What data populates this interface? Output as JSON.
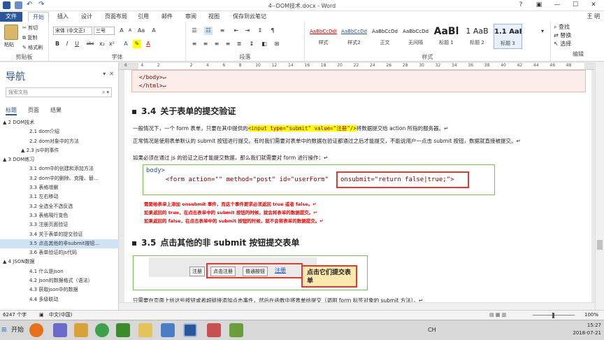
{
  "window": {
    "title": "4--DOM技术.docx - Word",
    "user": "王 明"
  },
  "tabs": [
    "文件",
    "开始",
    "插入",
    "设计",
    "页面布局",
    "引用",
    "邮件",
    "审阅",
    "视图",
    "保存到云笔记"
  ],
  "ribbon": {
    "clipboard": {
      "paste": "粘贴",
      "cut": "剪切",
      "copy": "复制",
      "format_painter": "格式刷",
      "label": "剪贴板"
    },
    "font": {
      "name": "宋体 (中文正)",
      "size": "三号",
      "label": "字体",
      "buttons": [
        "B",
        "I",
        "U",
        "abc",
        "x₂",
        "x²"
      ],
      "size_buttons": [
        "A",
        "A",
        "Aa",
        "A"
      ]
    },
    "paragraph": {
      "label": "段落"
    },
    "styles": {
      "label": "样式",
      "items": [
        {
          "preview": "AaBbCcDdI",
          "name": "样式"
        },
        {
          "preview": "AaBbCcDd",
          "name": "样式2"
        },
        {
          "preview": "AaBbCcDd",
          "name": "正文"
        },
        {
          "preview": "AaBbCcDd",
          "name": "无间隔"
        },
        {
          "preview": "AaBl",
          "name": "标题 1"
        },
        {
          "preview": "1 AaB",
          "name": "标题 2"
        },
        {
          "preview": "1.1 AaB",
          "name": "标题 3"
        }
      ]
    },
    "editing": {
      "label": "编辑",
      "find": "查找",
      "replace": "替换",
      "select": "选择"
    }
  },
  "ruler_ticks": [
    "6",
    "4",
    "2",
    "",
    "2",
    "4",
    "6",
    "8",
    "10",
    "12",
    "14",
    "16",
    "18",
    "20",
    "22",
    "24",
    "26",
    "28",
    "30",
    "32",
    "34",
    "36",
    "38",
    "40",
    "42",
    "44",
    "46",
    "48"
  ],
  "nav": {
    "title": "导航",
    "search_placeholder": "搜索文档",
    "tabs": [
      "标题",
      "页面",
      "结果"
    ],
    "items": [
      "▲ 2 DOM技术",
      "2.1 dom介绍",
      "2.2 dom对象中的方法",
      "▲ 2.3 js中的事件",
      "▲ 3 DOM练习",
      "3.1 dom中的创建和添加方法",
      "3.2 dom中的删除、克隆、替...",
      "3.3 表格增删",
      "3.1 左右移动",
      "3.2 全选全不选反选",
      "3.3 表格隔行变色",
      "3.3 注册页面验证",
      "3.4 关于表单的提交验证",
      "3.5 点击其他的非submit按钮...",
      "3.6 表单验证的js代码",
      "▲ 4 JSON数据",
      "4.1 什么是json",
      "4.2 json的数据格式（语法）",
      "4.3 获取json中的数据",
      "4.4 多级联动"
    ],
    "selected_index": 13
  },
  "doc": {
    "code_top": [
      "</body>↵",
      "</html>↵"
    ],
    "h34": {
      "num": "3.4",
      "text": "关于表单的提交验证"
    },
    "p1_a": "一般情况下，一个 form 表单，只要在其中提供的",
    "p1_hl": "<input type=\"submit\" value=\"注册\"/>",
    "p1_b": "将数据提交给 action 所指的服务器。↵",
    "p2": "正常情况是使用表单默认的 submit 按钮进行提交。有时我们需要对表单中的数据在验证都通过之后才能提交，不能说用户一点击 submit 按钮，数据就直接被提交。↵",
    "p3": "如果必须在通过 js 的验证之后才能提交数据，那么我们就需要对 form 进行操作：↵",
    "code_line1": "body>",
    "code_line2": "<form action=\"\" method=\"post\" id=\"userForm\"",
    "code_line2b": "onsubmit=\"return false|true;\">",
    "notes": [
      "需要给表单上添加 onsubmit 事件，而这个事件要求必须返回 true 或者 false。↵",
      "如果返回的 true，在点击表单中的 submit 按钮的时候，就会将表单的数据提交。↵",
      "如果返回的 false，在点击表单中的 submit 按钮的时候，就不会将表单的数据提交。↵"
    ],
    "h35": {
      "num": "3.5",
      "text": "点击其他的非 submit 按钮提交表单"
    },
    "demo_buttons": [
      "注册",
      "点击注册",
      "普通按钮"
    ],
    "demo_link": "注册",
    "callout": "点击它们提交表单",
    "p4": "只需要在页面上给这些按钮或者超链接添加点击事件，然后在函数中将表单给提交（调用 form 标签对象的 submit 方法）。↵"
  },
  "status": {
    "words": "6247 个字",
    "lang": "中文(中国)",
    "zoom": "100%"
  },
  "taskbar": {
    "start": "开始",
    "time": "15:27",
    "date": "2018-07-21",
    "ime": "CH"
  },
  "colors": {
    "word_blue": "#2b579a",
    "highlight": "#ffff00",
    "annot_red": "#e13b2e",
    "code_green": "#77c24a"
  }
}
